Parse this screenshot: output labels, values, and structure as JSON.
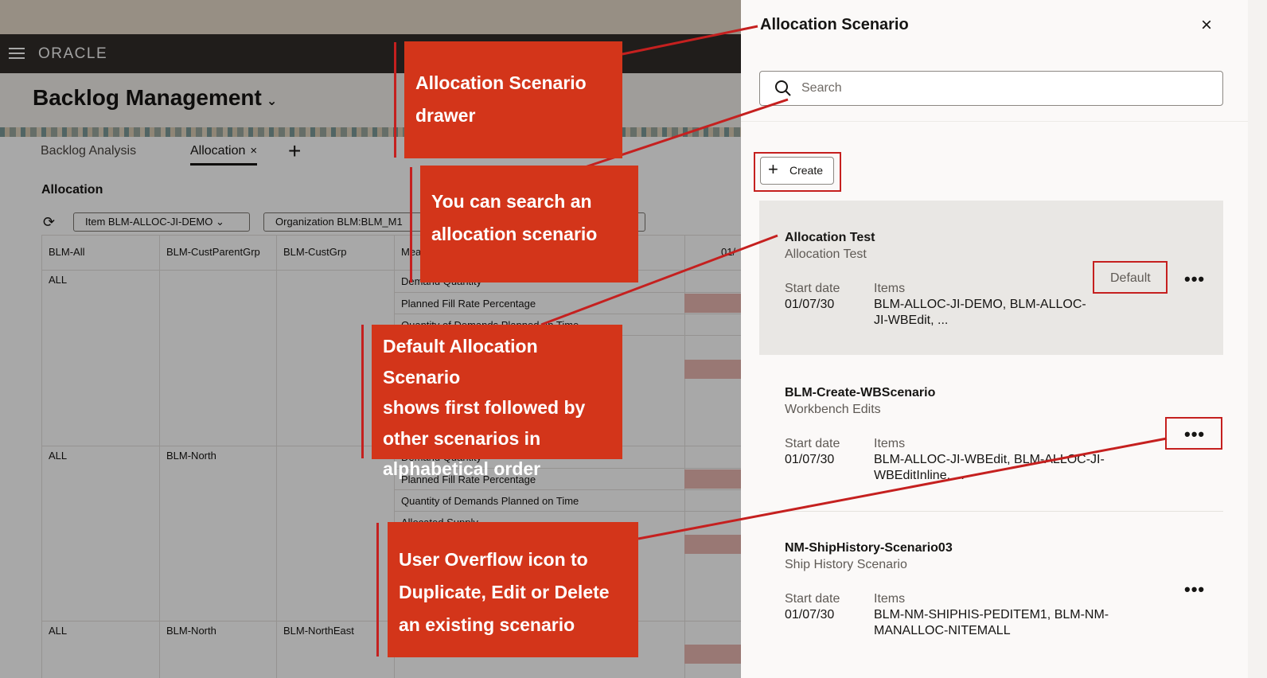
{
  "app": {
    "logo": "ORACLE",
    "page_title": "Backlog Management",
    "tabs": [
      {
        "label": "Backlog Analysis"
      },
      {
        "label": "Allocation"
      }
    ],
    "tab_close": "×",
    "tab_add": "+",
    "section_title": "Allocation",
    "filters": [
      {
        "label": "Item BLM-ALLOC-JI-DEMO"
      },
      {
        "label": "Organization BLM:BLM_M1"
      }
    ],
    "column_headers": [
      "BLM-All",
      "BLM-CustParentGrp",
      "BLM-CustGrp",
      "Mea",
      "01/"
    ],
    "rows": [
      {
        "c1": "ALL",
        "c2": "",
        "c3": ""
      },
      {
        "c1": "ALL",
        "c2": "BLM-North",
        "c3": ""
      },
      {
        "c1": "ALL",
        "c2": "BLM-North",
        "c3": "BLM-NorthEast"
      }
    ],
    "measures": [
      "Demand Quantity",
      "Planned Fill Rate Percentage",
      "Quantity of Demands Planned on Time",
      "Demand Quantity",
      "Planned Fill Rate Percentage",
      "Quantity of Demands Planned on Time",
      "Allocated Supply"
    ]
  },
  "drawer": {
    "title": "Allocation Scenario",
    "close": "×",
    "search_placeholder": "Search",
    "create_label": "Create",
    "start_date_label": "Start date",
    "items_label": "Items",
    "more": "•••",
    "scenarios": [
      {
        "name": "Allocation Test",
        "description": "Allocation Test",
        "start_date": "01/07/30",
        "items_line1": "BLM-ALLOC-JI-DEMO, BLM-ALLOC-",
        "items_line2": "JI-WBEdit, ...",
        "badge": "Default"
      },
      {
        "name": "BLM-Create-WBScenario",
        "description": "Workbench Edits",
        "start_date": "01/07/30",
        "items_line1": "BLM-ALLOC-JI-WBEdit, BLM-ALLOC-JI-",
        "items_line2": "WBEditInline, ..."
      },
      {
        "name": "NM-ShipHistory-Scenario03",
        "description": "Ship History Scenario",
        "start_date": "01/07/30",
        "items_line1": "BLM-NM-SHIPHIS-PEDITEM1, BLM-NM-",
        "items_line2": "MANALLOC-NITEMALL"
      }
    ]
  },
  "annotations": {
    "drawer": [
      "Allocation Scenario",
      "drawer"
    ],
    "search": [
      "You can search an",
      "allocation scenario"
    ],
    "default": [
      "Default Allocation Scenario",
      "shows first followed by",
      "other scenarios in",
      "alphabetical order"
    ],
    "overflow": [
      "User Overflow icon to",
      "Duplicate, Edit or Delete",
      "an existing scenario"
    ]
  },
  "colors": {
    "callout": "#d3351a",
    "annotation_line": "#c5201f",
    "header_bar": "#312d2a",
    "drawer_bg": "#fbf9f8",
    "highlight_card": "#e9e7e4"
  }
}
